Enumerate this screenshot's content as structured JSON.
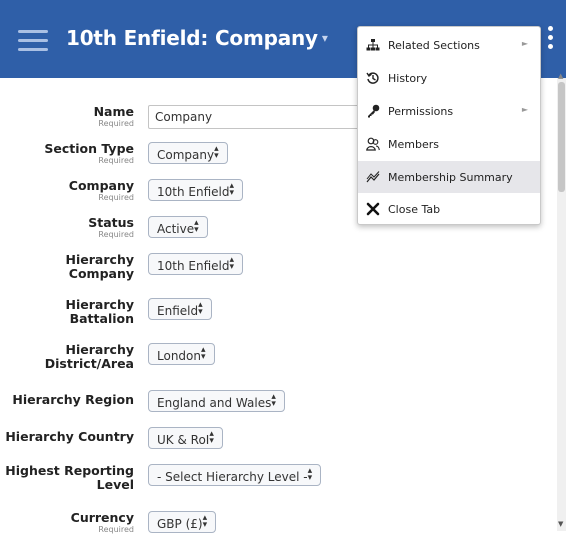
{
  "header": {
    "title": "10th Enfield: Company",
    "title_caret": "▾",
    "menu_icon": "hamburger-icon",
    "more_icon": "kebab-icon",
    "color": "#2f5fa8"
  },
  "form": {
    "required_label": "Required",
    "name": {
      "label": "Name",
      "value": "Company"
    },
    "section_type": {
      "label": "Section Type",
      "value": "Company"
    },
    "company": {
      "label": "Company",
      "value": "10th Enfield"
    },
    "status": {
      "label": "Status",
      "value": "Active"
    },
    "hierarchy_company": {
      "label": "Hierarchy Company",
      "value": "10th Enfield"
    },
    "hierarchy_battalion": {
      "label": "Hierarchy Battalion",
      "value": "Enfield"
    },
    "hierarchy_district": {
      "label": "Hierarchy District/Area",
      "value": "London"
    },
    "hierarchy_region": {
      "label": "Hierarchy Region",
      "value": "England and Wales"
    },
    "hierarchy_country": {
      "label": "Hierarchy Country",
      "value": "UK & RoI"
    },
    "highest_reporting": {
      "label": "Highest Reporting Level",
      "value": "- Select Hierarchy Level -"
    },
    "currency": {
      "label": "Currency",
      "value": "GBP (£)"
    }
  },
  "menu": {
    "items": [
      {
        "label": "Related Sections",
        "icon": "sitemap-icon",
        "submenu": true
      },
      {
        "label": "History",
        "icon": "history-icon",
        "submenu": false
      },
      {
        "label": "Permissions",
        "icon": "key-icon",
        "submenu": true
      },
      {
        "label": "Members",
        "icon": "members-icon",
        "submenu": false
      },
      {
        "label": "Membership Summary",
        "icon": "chart-line-icon",
        "submenu": false,
        "highlighted": true
      },
      {
        "label": "Close Tab",
        "icon": "close-icon",
        "submenu": false
      }
    ]
  }
}
